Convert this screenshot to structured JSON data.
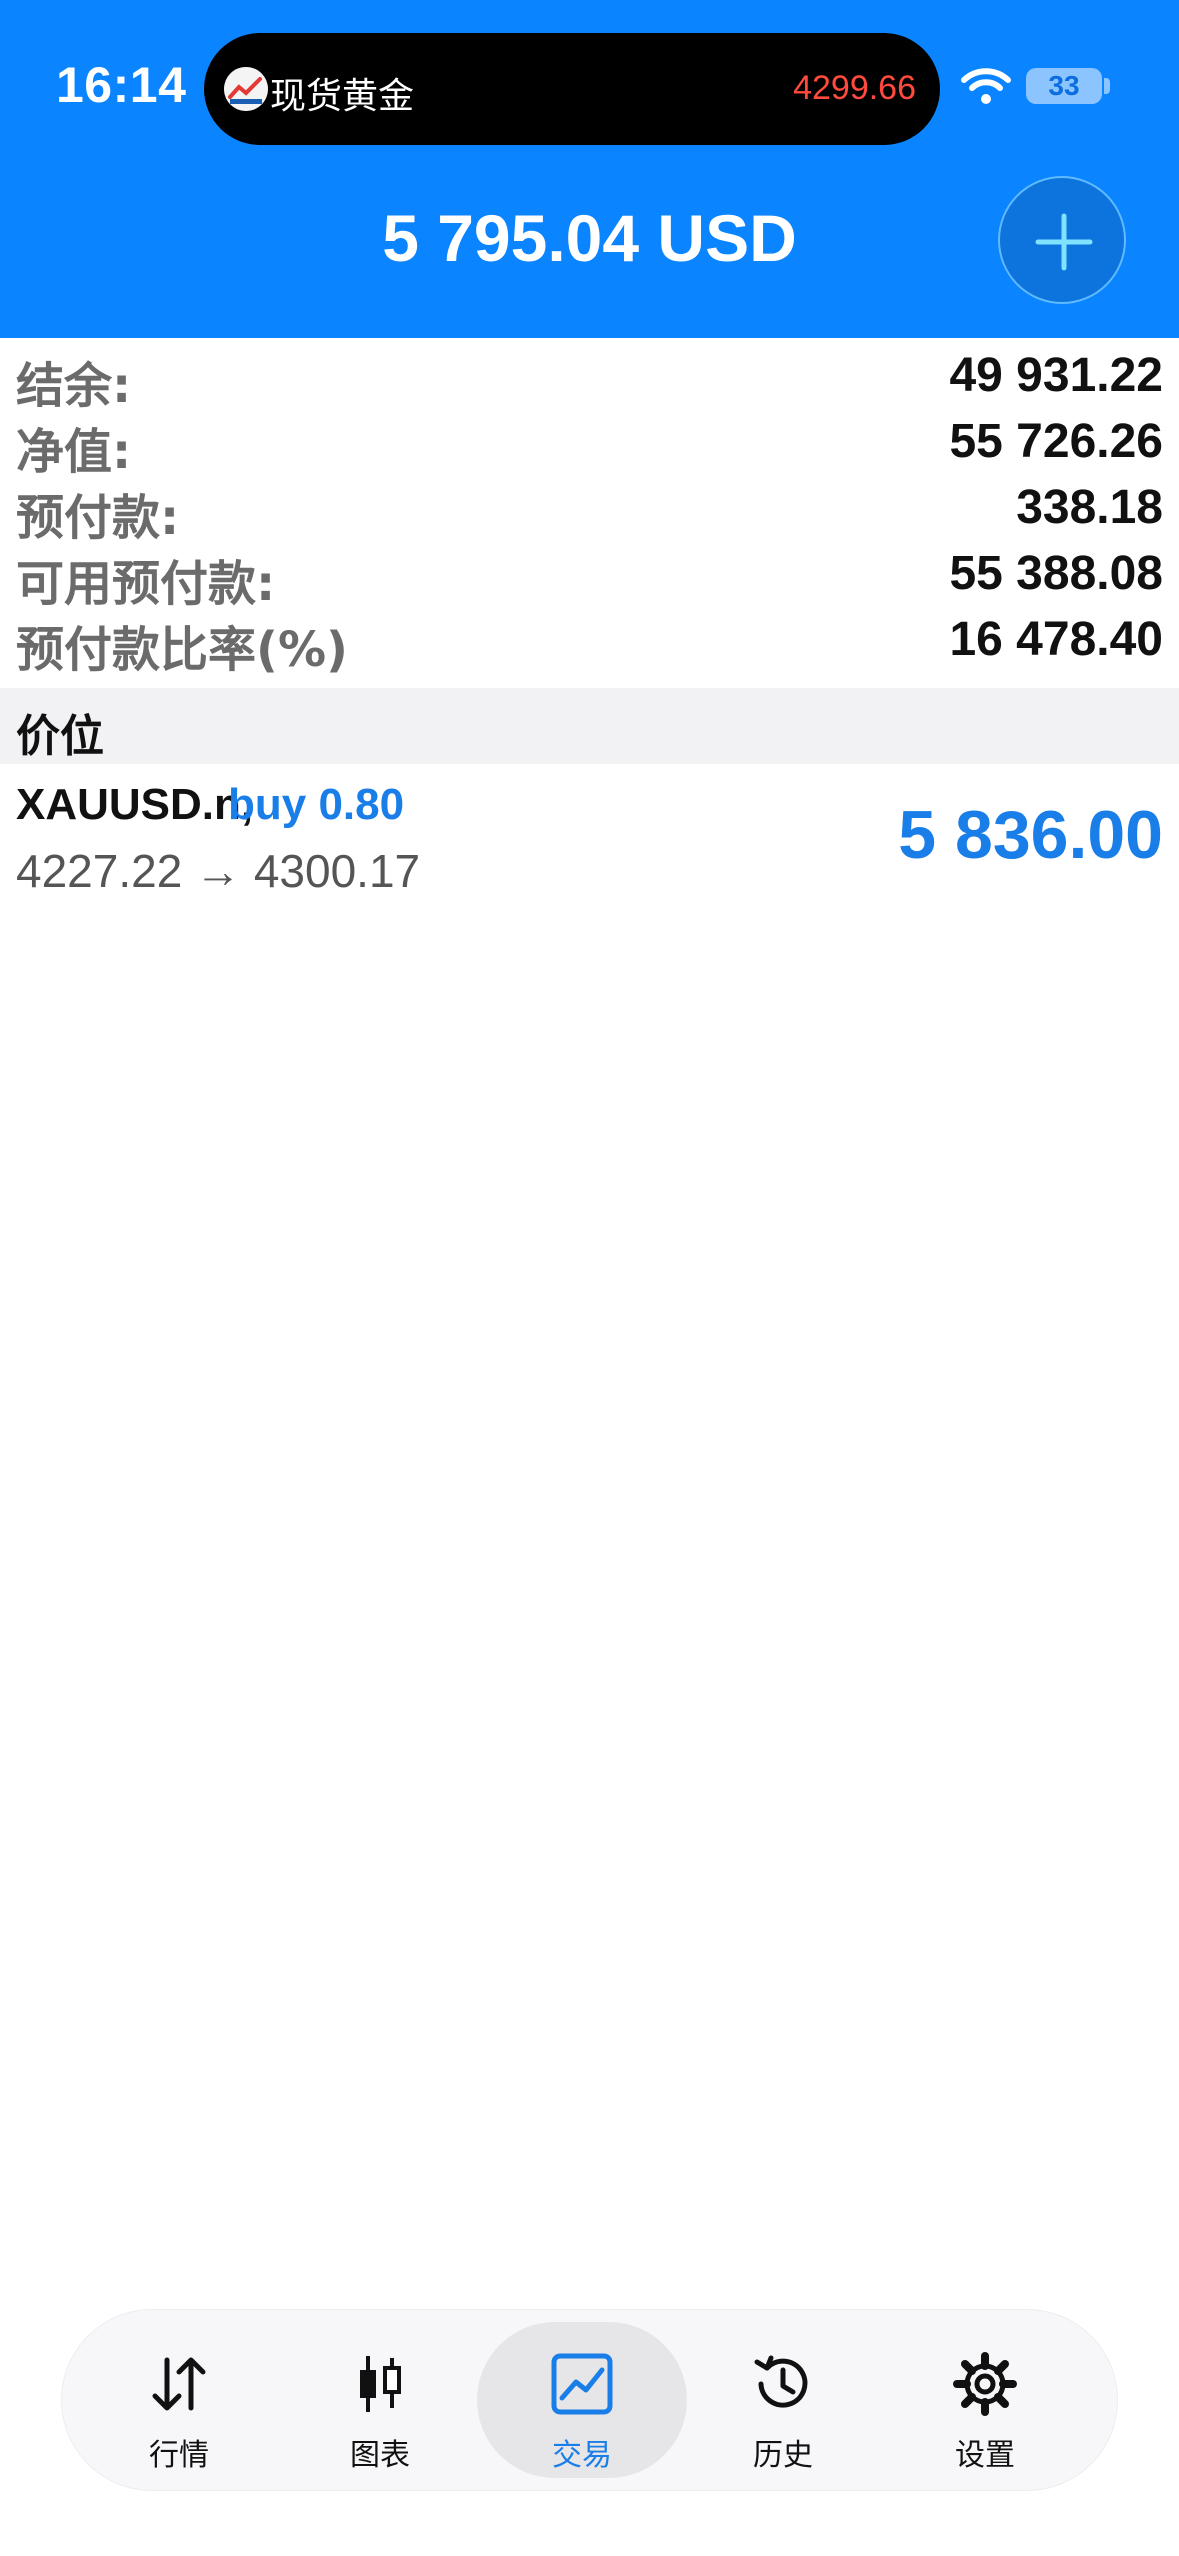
{
  "status_bar": {
    "time": "16:14",
    "island_title": "现货黄金",
    "island_price": "4299.66",
    "battery": "33"
  },
  "header": {
    "total": "5 795.04 USD"
  },
  "summary": [
    {
      "label": "结余:",
      "value": "49 931.22"
    },
    {
      "label": "净值:",
      "value": "55 726.26"
    },
    {
      "label": "预付款:",
      "value": "338.18"
    },
    {
      "label": "可用预付款:",
      "value": "55 388.08"
    },
    {
      "label": "预付款比率(%)",
      "value": "16 478.40"
    }
  ],
  "positions_section": {
    "title": "价位"
  },
  "positions": [
    {
      "symbol": "XAUUSD.n,",
      "side": "buy 0.80",
      "prices": "4227.22 → 4300.17",
      "profit": "5 836.00"
    }
  ],
  "tabs": [
    {
      "label": "行情",
      "icon": "arrows-updown-icon",
      "active": false
    },
    {
      "label": "图表",
      "icon": "candlestick-icon",
      "active": false
    },
    {
      "label": "交易",
      "icon": "trade-chart-icon",
      "active": true
    },
    {
      "label": "历史",
      "icon": "history-icon",
      "active": false
    },
    {
      "label": "设置",
      "icon": "gear-icon",
      "active": false
    }
  ],
  "colors": {
    "header_blue": "#0a84ff",
    "accent_blue": "#1a7ee8",
    "island_price_red": "#ff4a3d"
  }
}
